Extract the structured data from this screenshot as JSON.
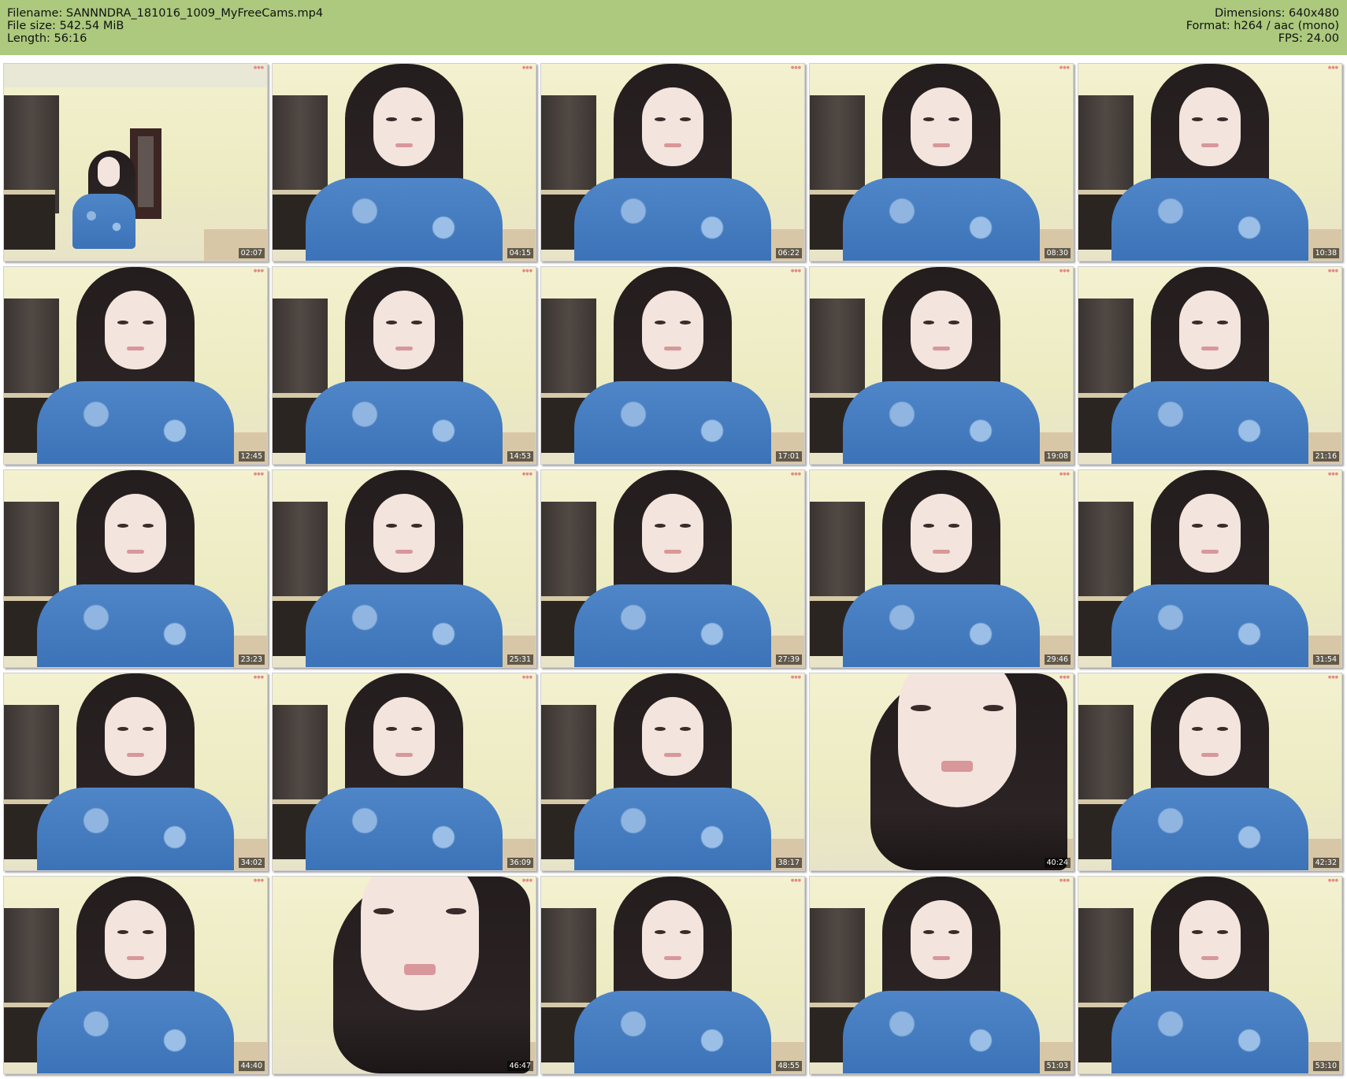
{
  "header": {
    "filename": "Filename: SANNNDRA_181016_1009_MyFreeCams.mp4",
    "file_size": "File size: 542.54 MiB",
    "length": "Length: 56:16",
    "dimensions": "Dimensions: 640x480",
    "format": "Format: h264 / aac (mono)",
    "fps": "FPS: 24.00"
  },
  "colors": {
    "header_bg": "#acc97e",
    "shirt": "#4f86c8",
    "wall": "#f3f1cf"
  },
  "thumbnails": [
    {
      "time": "02:07",
      "variant": "wide"
    },
    {
      "time": "04:15",
      "variant": "normal"
    },
    {
      "time": "06:22",
      "variant": "normal"
    },
    {
      "time": "08:30",
      "variant": "normal"
    },
    {
      "time": "10:38",
      "variant": "normal"
    },
    {
      "time": "12:45",
      "variant": "normal"
    },
    {
      "time": "14:53",
      "variant": "normal"
    },
    {
      "time": "17:01",
      "variant": "normal"
    },
    {
      "time": "19:08",
      "variant": "normal"
    },
    {
      "time": "21:16",
      "variant": "normal"
    },
    {
      "time": "23:23",
      "variant": "normal"
    },
    {
      "time": "25:31",
      "variant": "normal"
    },
    {
      "time": "27:39",
      "variant": "normal"
    },
    {
      "time": "29:46",
      "variant": "normal"
    },
    {
      "time": "31:54",
      "variant": "normal"
    },
    {
      "time": "34:02",
      "variant": "normal"
    },
    {
      "time": "36:09",
      "variant": "normal"
    },
    {
      "time": "38:17",
      "variant": "normal"
    },
    {
      "time": "40:24",
      "variant": "close"
    },
    {
      "time": "42:32",
      "variant": "normal"
    },
    {
      "time": "44:40",
      "variant": "normal"
    },
    {
      "time": "46:47",
      "variant": "close"
    },
    {
      "time": "48:55",
      "variant": "normal"
    },
    {
      "time": "51:03",
      "variant": "normal"
    },
    {
      "time": "53:10",
      "variant": "normal"
    }
  ]
}
